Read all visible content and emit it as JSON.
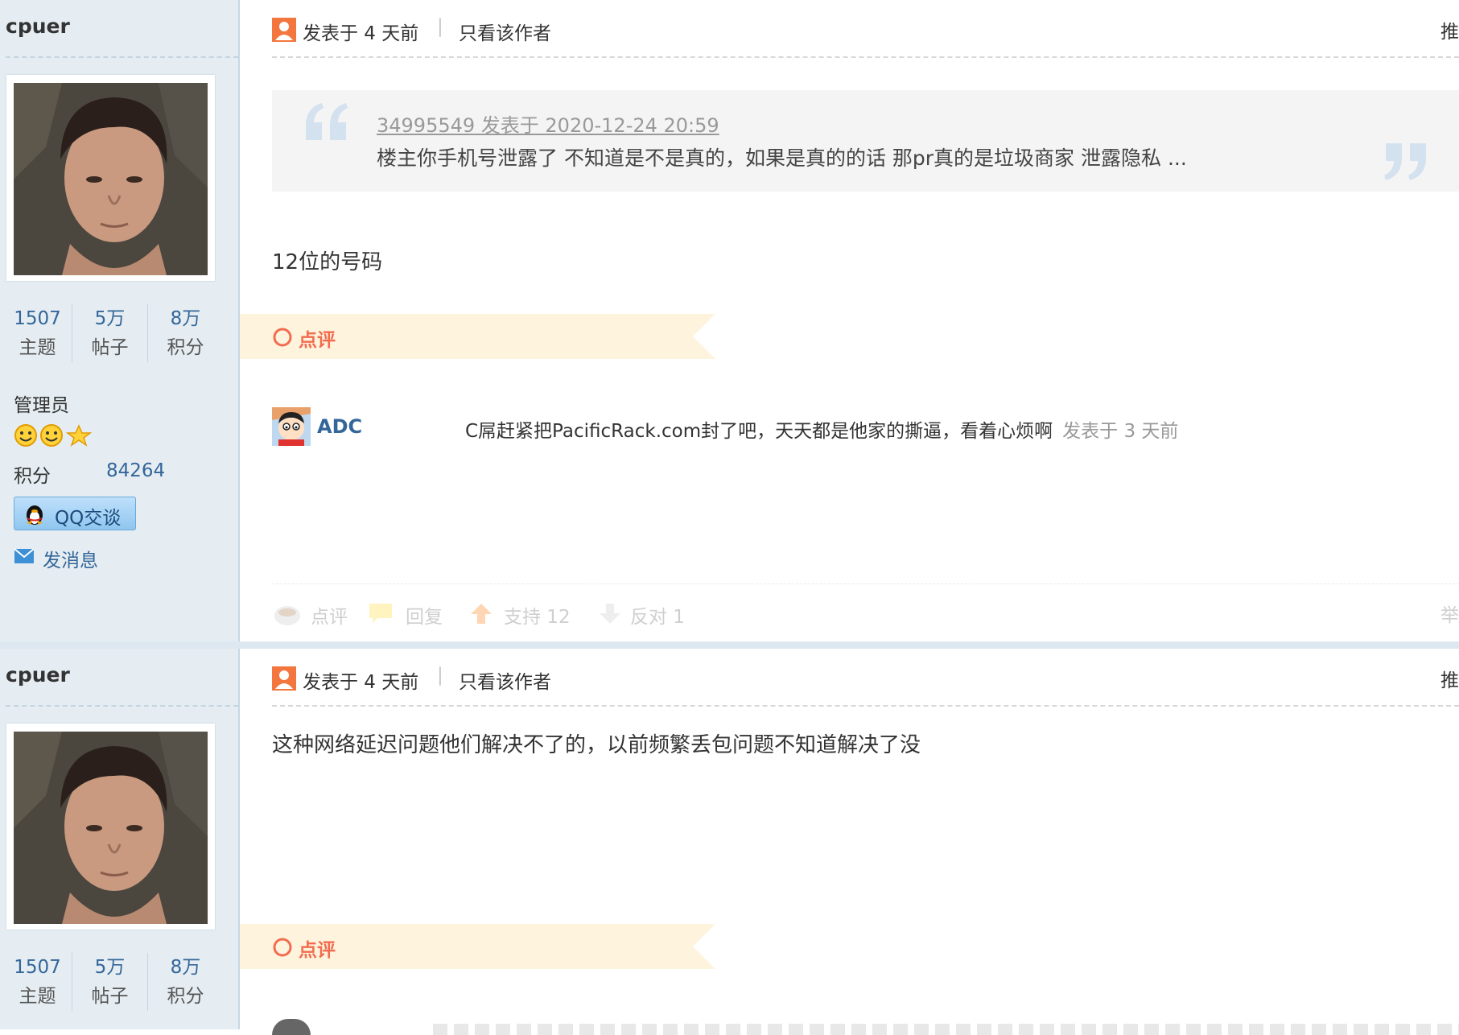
{
  "posts": [
    {
      "user": {
        "name": "cpuer",
        "stats": [
          {
            "value": "1507",
            "label": "主题"
          },
          {
            "value": "5万",
            "label": "帖子"
          },
          {
            "value": "8万",
            "label": "积分"
          }
        ],
        "group": "管理员",
        "score_label": "积分",
        "score_value": "84264",
        "qq_button": "QQ交谈",
        "message_link": "发消息"
      },
      "header": {
        "posted": "发表于 4 天前",
        "separator": "|",
        "only_author": "只看该作者",
        "right": "推"
      },
      "quote": {
        "source": "34995549 发表于 2020-12-24 20:59",
        "text": "楼主你手机号泄露了  不知道是不是真的，如果是真的的话 那pr真的是垃圾商家 泄露隐私 ..."
      },
      "body": "12位的号码",
      "review_label": "点评",
      "comment": {
        "author": "ADC",
        "text": "C屌赶紧把PacificRack.com封了吧，天天都是他家的撕逼，看着心烦啊",
        "time": "发表于 3 天前"
      },
      "actions": {
        "review": "点评",
        "reply": "回复",
        "support": "支持 12",
        "oppose": "反对 1",
        "report": "举"
      }
    },
    {
      "user": {
        "name": "cpuer",
        "stats": [
          {
            "value": "1507",
            "label": "主题"
          },
          {
            "value": "5万",
            "label": "帖子"
          },
          {
            "value": "8万",
            "label": "积分"
          }
        ]
      },
      "header": {
        "posted": "发表于 4 天前",
        "separator": "|",
        "only_author": "只看该作者",
        "right": "推"
      },
      "body": "这种网络延迟问题他们解决不了的，以前频繁丢包问题不知道解决了没",
      "review_label": "点评"
    }
  ],
  "colors": {
    "sidebar_bg": "#e5edf2",
    "link_blue": "#336699",
    "ribbon_bg": "#fef3dd",
    "accent_orange": "#f26c4f"
  }
}
